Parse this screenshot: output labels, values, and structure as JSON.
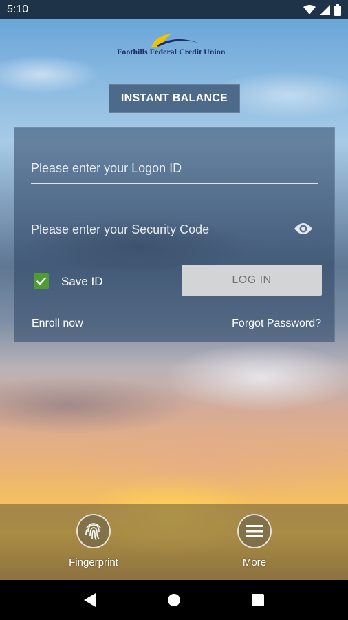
{
  "status_bar": {
    "time": "5:10"
  },
  "brand": {
    "name": "Foothills Federal Credit Union"
  },
  "instant_balance_label": "INSTANT BALANCE",
  "login": {
    "logon_placeholder": "Please enter your Logon ID",
    "logon_value": "",
    "security_placeholder": "Please enter your Security Code",
    "security_value": "",
    "save_id_label": "Save ID",
    "save_id_checked": true,
    "login_label": "LOG IN",
    "enroll_label": "Enroll now",
    "forgot_label": "Forgot Password?"
  },
  "bottom_nav": {
    "fingerprint_label": "Fingerprint",
    "more_label": "More"
  },
  "colors": {
    "status_bar": "#1e3348",
    "instant_balance_bg": "#4d6a8a",
    "checkbox": "#4f9c37",
    "login_button": "#d3d4d6",
    "brand_blue": "#1d2f67",
    "brand_yellow": "#f2c200"
  },
  "icons": [
    "wifi-icon",
    "signal-icon",
    "battery-icon",
    "eye-icon",
    "fingerprint-icon",
    "menu-icon",
    "back-icon",
    "home-icon",
    "recents-icon"
  ]
}
